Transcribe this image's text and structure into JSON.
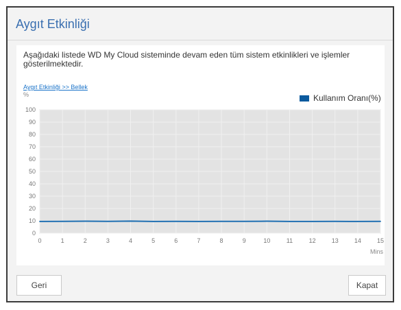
{
  "dialog": {
    "title": "Aygıt Etkinliği",
    "description": "Aşağıdaki listede WD My Cloud  sisteminde devam eden tüm sistem etkinlikleri ve işlemler gösterilmektedir.",
    "breadcrumb": "Aygıt Etkinliği >> Bellek",
    "back_label": "Geri",
    "close_label": "Kapat"
  },
  "chart_data": {
    "type": "line",
    "ylabel": "%",
    "xlabel": "Mins",
    "ylim": [
      0,
      100
    ],
    "xlim": [
      0,
      15
    ],
    "y_ticks": [
      0,
      10,
      20,
      30,
      40,
      50,
      60,
      70,
      80,
      90,
      100
    ],
    "x_ticks": [
      0,
      1,
      2,
      3,
      4,
      5,
      6,
      7,
      8,
      9,
      10,
      11,
      12,
      13,
      14,
      15
    ],
    "grid": true,
    "legend_position": "top-right",
    "series": [
      {
        "name": "Kullanım Oranı(%)",
        "color": "#1f6fb2",
        "x": [
          0,
          1,
          2,
          3,
          4,
          5,
          6,
          7,
          8,
          9,
          10,
          11,
          12,
          13,
          14,
          15
        ],
        "values": [
          9.5,
          9.6,
          9.7,
          9.6,
          9.8,
          9.5,
          9.6,
          9.5,
          9.6,
          9.6,
          9.7,
          9.5,
          9.5,
          9.6,
          9.5,
          9.6
        ]
      }
    ],
    "colors": {
      "plot_background": "#e3e3e3",
      "gridline": "#f0f0f0"
    }
  }
}
